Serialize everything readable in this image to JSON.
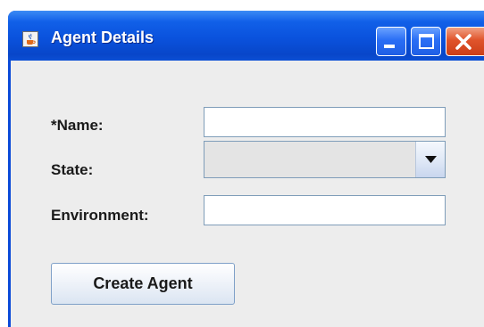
{
  "window": {
    "title": "Agent Details",
    "app_icon": "java-cup-icon",
    "controls": [
      {
        "name": "minimize",
        "icon": "minimize-icon"
      },
      {
        "name": "maximize",
        "icon": "maximize-icon"
      },
      {
        "name": "close",
        "icon": "close-icon"
      }
    ]
  },
  "form": {
    "name_label": "*Name:",
    "name_value": "",
    "state_label": "State:",
    "state_value": "",
    "environment_label": "Environment:",
    "environment_value": "",
    "submit_label": "Create Agent"
  },
  "colors": {
    "titlebar": "#0a52dd",
    "close_button": "#e0542b",
    "panel": "#ededed"
  }
}
